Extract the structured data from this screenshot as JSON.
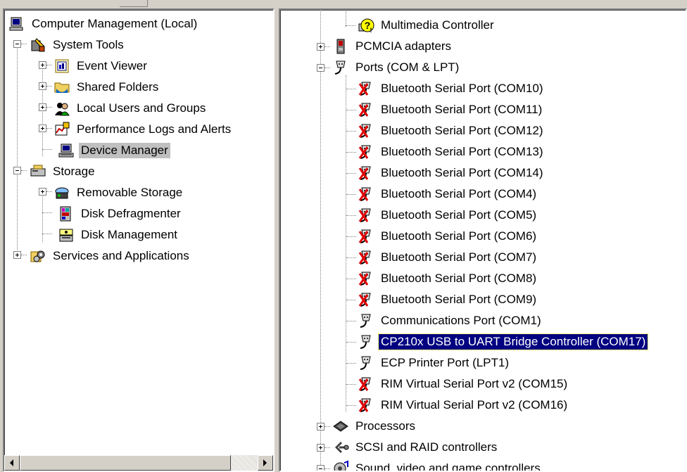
{
  "left_tree": {
    "root": "Computer Management (Local)",
    "system_tools": "System Tools",
    "event_viewer": "Event Viewer",
    "shared_folders": "Shared Folders",
    "local_users": "Local Users and Groups",
    "perf_logs": "Performance Logs and Alerts",
    "device_manager": "Device Manager",
    "storage": "Storage",
    "removable_storage": "Removable Storage",
    "disk_defrag": "Disk Defragmenter",
    "disk_mgmt": "Disk Management",
    "services": "Services and Applications"
  },
  "right_tree": {
    "multimedia": "Multimedia Controller",
    "pcmcia": "PCMCIA adapters",
    "ports": "Ports (COM & LPT)",
    "port_items": [
      "Bluetooth Serial Port (COM10)",
      "Bluetooth Serial Port (COM11)",
      "Bluetooth Serial Port (COM12)",
      "Bluetooth Serial Port (COM13)",
      "Bluetooth Serial Port (COM14)",
      "Bluetooth Serial Port (COM4)",
      "Bluetooth Serial Port (COM5)",
      "Bluetooth Serial Port (COM6)",
      "Bluetooth Serial Port (COM7)",
      "Bluetooth Serial Port (COM8)",
      "Bluetooth Serial Port (COM9)",
      "Communications Port (COM1)",
      "CP210x USB to UART Bridge Controller (COM17)",
      "ECP Printer Port (LPT1)",
      "RIM Virtual Serial Port v2 (COM15)",
      "RIM Virtual Serial Port v2 (COM16)"
    ],
    "processors": "Processors",
    "scsi": "SCSI and RAID controllers",
    "sound": "Sound, video and game controllers"
  },
  "icons": {
    "computer": "computer-icon",
    "tools": "system-tools-icon",
    "event_viewer": "event-viewer-icon",
    "folder": "shared-folder-icon",
    "users": "users-icon",
    "perf": "performance-icon",
    "device_manager": "device-manager-icon",
    "storage": "storage-icon",
    "removable": "removable-storage-icon",
    "defrag": "disk-defragmenter-icon",
    "disk": "disk-management-icon",
    "services": "services-icon",
    "warning": "warning-device-icon",
    "pcmcia": "pcmcia-icon",
    "port": "port-connector-icon",
    "port_disabled": "port-disabled-icon",
    "processor": "processor-icon",
    "scsi": "scsi-icon",
    "sound": "sound-icon"
  },
  "colors": {
    "selection_blue": "#000080",
    "selection_gray": "#c0c0c0",
    "window_bg": "#d4d0c8",
    "disabled_x": "#e00000"
  }
}
